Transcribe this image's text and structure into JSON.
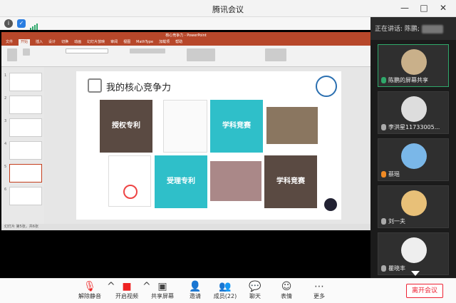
{
  "app": {
    "title": "腾讯会议"
  },
  "speaker": {
    "label": "正在讲话: 陈鹏;"
  },
  "participants": [
    {
      "name": "陈鹏的屏幕共享"
    },
    {
      "name": "李洪星11733005..."
    },
    {
      "name": "蔡瑶"
    },
    {
      "name": "刘一夫"
    },
    {
      "name": "瞿晓丰"
    }
  ],
  "ppt": {
    "title": "核心竞争力 - PowerPoint",
    "tabs": [
      "文件",
      "开始",
      "插入",
      "设计",
      "切换",
      "动画",
      "幻灯片放映",
      "审阅",
      "视图",
      "MathType",
      "加载项",
      "帮助"
    ],
    "slide_title": "我的核心竞争力",
    "blocks": [
      "授权专利",
      "学科竞赛",
      "受理专利",
      "学科竞赛"
    ],
    "status": "幻灯片 第5张，共6张"
  },
  "toolbar": {
    "unmute": "解除静音",
    "video": "开启视频",
    "share": "共享屏幕",
    "invite": "邀请",
    "members": "成员(22)",
    "chat": "聊天",
    "emoji": "表情",
    "more": "更多",
    "leave": "离开会议"
  },
  "colors": {
    "accent_red": "#e22",
    "teal": "#2fbfc9",
    "brown": "#5a4a42",
    "ppt_red": "#b7472a"
  }
}
